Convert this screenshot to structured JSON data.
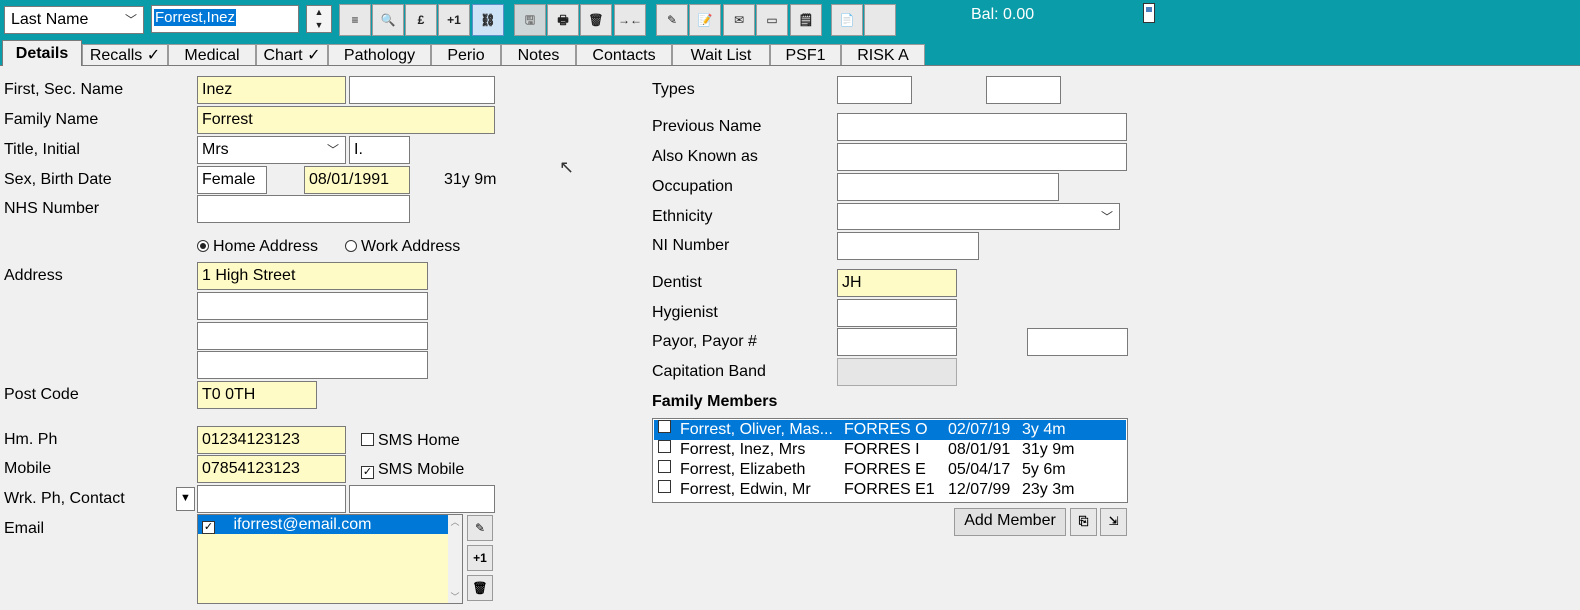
{
  "toolbar": {
    "search_field": "Last Name",
    "search_value": "Forrest,Inez",
    "balance": "Bal: 0.00",
    "buttons": [
      {
        "icon": "align-left-icon",
        "glyph": "≡"
      },
      {
        "icon": "search-icon",
        "glyph": "🔍"
      },
      {
        "icon": "pound-icon",
        "glyph": "£"
      },
      {
        "icon": "plus-one-icon",
        "glyph": "+1"
      },
      {
        "icon": "link-icon",
        "glyph": "⛓"
      },
      {
        "icon": "save-icon",
        "glyph": "🖫"
      },
      {
        "icon": "print-icon",
        "glyph": "🖶"
      },
      {
        "icon": "delete-icon",
        "glyph": "🗑"
      },
      {
        "icon": "merge-icon",
        "glyph": "→←"
      },
      {
        "icon": "pen-icon",
        "glyph": "✎"
      },
      {
        "icon": "document-edit-icon",
        "glyph": "📝"
      },
      {
        "icon": "mail-icon",
        "glyph": "✉"
      },
      {
        "icon": "card-icon",
        "glyph": "▭"
      },
      {
        "icon": "note-icon",
        "glyph": "🗒"
      },
      {
        "icon": "documents-icon",
        "glyph": "📄"
      },
      {
        "icon": "blank-icon",
        "glyph": ""
      }
    ]
  },
  "tabs": [
    "Details",
    "Recalls ✓",
    "Medical",
    "Chart ✓",
    "Pathology",
    "Perio",
    "Notes",
    "Contacts",
    "Wait List",
    "PSF1",
    "RISK A"
  ],
  "left": {
    "labels": {
      "first_sec_name": "First, Sec. Name",
      "family_name": "Family Name",
      "title_initial": "Title, Initial",
      "sex_birth": "Sex, Birth Date",
      "nhs": "NHS Number",
      "address": "Address",
      "postcode": "Post Code",
      "hm_ph": "Hm. Ph",
      "mobile": "Mobile",
      "wrk_ph": "Wrk. Ph, Contact",
      "email": "Email"
    },
    "values": {
      "first_name": "Inez",
      "second_name": "",
      "family_name": "Forrest",
      "title": "Mrs",
      "initial": "I.",
      "sex": "Female",
      "birth_date": "08/01/1991",
      "age": "31y 9m",
      "nhs": "",
      "address1": "1 High Street",
      "address2": "",
      "address3": "",
      "address4": "",
      "postcode": "T0 0TH",
      "hm_ph": "01234123123",
      "mobile": "07854123123",
      "wrk_ph": "",
      "contact": "",
      "email": "iforrest@email.com"
    },
    "home_address": "Home Address",
    "work_address": "Work Address",
    "sms_home": "SMS Home",
    "sms_mobile": "SMS Mobile"
  },
  "right": {
    "labels": {
      "types": "Types",
      "previous_name": "Previous Name",
      "also_known": "Also Known as",
      "occupation": "Occupation",
      "ethnicity": "Ethnicity",
      "ni": "NI Number",
      "dentist": "Dentist",
      "hygienist": "Hygienist",
      "payor": "Payor, Payor #",
      "capitation": "Capitation Band",
      "family_members": "Family Members"
    },
    "values": {
      "dentist": "JH"
    },
    "family": [
      {
        "name": "Forrest, Oliver, Mas...",
        "code": "FORRES O",
        "dob": "02/07/19",
        "age": "3y 4m"
      },
      {
        "name": "Forrest, Inez, Mrs",
        "code": "FORRES I",
        "dob": "08/01/91",
        "age": "31y 9m"
      },
      {
        "name": "Forrest, Elizabeth",
        "code": "FORRES E",
        "dob": "05/04/17",
        "age": "5y 6m"
      },
      {
        "name": "Forrest, Edwin, Mr",
        "code": "FORRES E1",
        "dob": "12/07/99",
        "age": "23y 3m"
      }
    ],
    "add_member": "Add Member"
  }
}
